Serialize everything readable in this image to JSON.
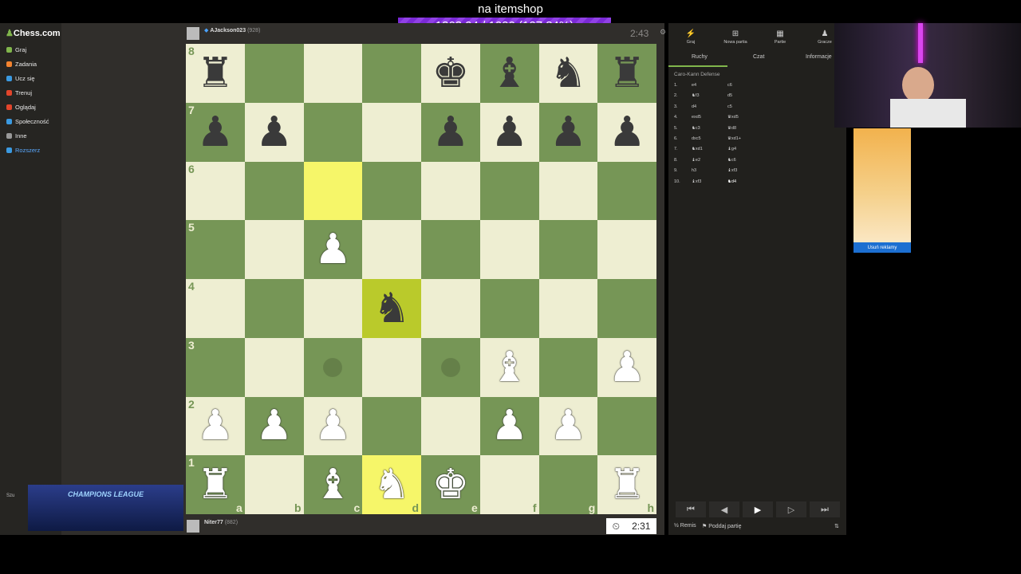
{
  "overlay": {
    "title": "na itemshop",
    "progress_text": "1303.94 / 1020 (127.84%)",
    "progress": 1.0
  },
  "sidebar": {
    "logo": "Chess.com",
    "items": [
      {
        "label": "Graj",
        "color": "#81b64c"
      },
      {
        "label": "Zadania",
        "color": "#f3832f"
      },
      {
        "label": "Ucz się",
        "color": "#3b9ae1"
      },
      {
        "label": "Trenuj",
        "color": "#e3452b"
      },
      {
        "label": "Oglądaj",
        "color": "#e3452b"
      },
      {
        "label": "Społeczność",
        "color": "#3b9ae1"
      },
      {
        "label": "Inne",
        "color": "#999999"
      },
      {
        "label": "Rozszerz",
        "color": "#3b9ae1"
      }
    ],
    "search_label": "Szu"
  },
  "top_player": {
    "name": "AJackson023",
    "rating": "(928)",
    "clock": "2:43"
  },
  "bottom_player": {
    "name": "Niter77",
    "rating": "(882)",
    "clock": "2:31"
  },
  "board": {
    "ranks": [
      "8",
      "7",
      "6",
      "5",
      "4",
      "3",
      "2",
      "1"
    ],
    "files": [
      "a",
      "b",
      "c",
      "d",
      "e",
      "f",
      "g",
      "h"
    ],
    "rows": [
      [
        "br",
        "",
        "",
        "",
        "bk",
        "bb",
        "bn",
        "br"
      ],
      [
        "bp",
        "bp",
        "",
        "",
        "bp",
        "bp",
        "bp",
        "bp"
      ],
      [
        "",
        "",
        "",
        "",
        "",
        "",
        "",
        ""
      ],
      [
        "",
        "",
        "wp",
        "",
        "",
        "",
        "",
        ""
      ],
      [
        "",
        "",
        "",
        "bn",
        "",
        "",
        "",
        ""
      ],
      [
        "",
        "",
        "",
        "",
        "",
        "wb",
        "",
        "wp"
      ],
      [
        "wp",
        "wp",
        "wp",
        "",
        "",
        "wp",
        "wp",
        ""
      ],
      [
        "wr",
        "",
        "wb",
        "wn",
        "wk",
        "",
        "",
        "wr"
      ]
    ],
    "highlight": [
      "c6",
      "d4",
      "d1"
    ],
    "move_dots": [
      "c3",
      "e3"
    ]
  },
  "right_panel": {
    "top_icons": [
      {
        "label": "Graj",
        "icon": "lightning-icon"
      },
      {
        "label": "Nowa partia",
        "icon": "plus-icon"
      },
      {
        "label": "Partie",
        "icon": "grid-icon"
      },
      {
        "label": "Gracze",
        "icon": "people-icon"
      }
    ],
    "tabs": [
      "Ruchy",
      "Czat",
      "Informacje"
    ],
    "opening": "Caro-Kann Defense",
    "moves": [
      {
        "n": "1.",
        "w": "e4",
        "b": "c6"
      },
      {
        "n": "2.",
        "w": "♞f3",
        "b": "d5"
      },
      {
        "n": "3.",
        "w": "d4",
        "b": "c5"
      },
      {
        "n": "4.",
        "w": "exd5",
        "b": "♛xd5"
      },
      {
        "n": "5.",
        "w": "♞c3",
        "b": "♛d8"
      },
      {
        "n": "6.",
        "w": "dxc5",
        "b": "♛xd1+"
      },
      {
        "n": "7.",
        "w": "♞xd1",
        "b": "♝g4"
      },
      {
        "n": "8.",
        "w": "♝e2",
        "b": "♞c6"
      },
      {
        "n": "9.",
        "w": "h3",
        "b": "♝xf3"
      },
      {
        "n": "10.",
        "w": "♝xf3",
        "b": "♞d4"
      }
    ],
    "nav": [
      "⏮",
      "◀",
      "▶",
      "▷",
      "⏭"
    ],
    "draw_label": "Remis",
    "resign_label": "Poddaj partię"
  },
  "ad": {
    "button": "Usuń reklamy"
  },
  "overlay_banner": "CHAMPIONS LEAGUE"
}
